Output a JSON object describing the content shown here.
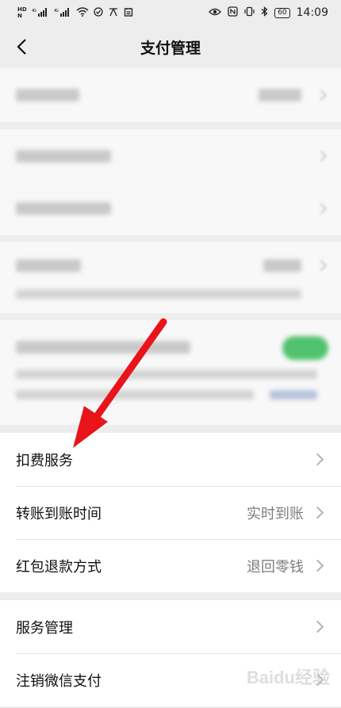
{
  "status_bar": {
    "left_indicators": [
      "HD",
      "N",
      "4G",
      "4G"
    ],
    "time": "14:09",
    "battery": "60"
  },
  "header": {
    "title": "支付管理"
  },
  "list_primary": [
    {
      "label": "扣费服务",
      "value": ""
    },
    {
      "label": "转账到账时间",
      "value": "实时到账"
    },
    {
      "label": "红包退款方式",
      "value": "退回零钱"
    }
  ],
  "list_secondary": [
    {
      "label": "服务管理",
      "value": ""
    },
    {
      "label": "注销微信支付",
      "value": ""
    }
  ],
  "icons": {
    "back": "chevron-left-icon",
    "row_arrow": "chevron-right-icon",
    "annotation": "red-arrow"
  },
  "colors": {
    "background": "#ededed",
    "card": "#ffffff",
    "secondary_text": "#7d7d7d",
    "toggle_on": "#51c26f",
    "arrow": "#e8141a"
  },
  "watermark": "Baidu经验"
}
